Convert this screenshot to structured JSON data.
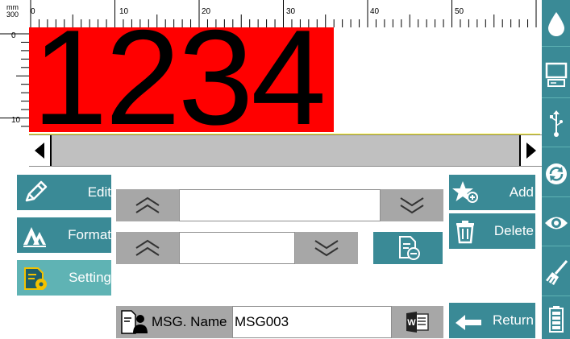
{
  "ruler": {
    "unit": "mm",
    "height_value": "300",
    "top_labels": [
      "0",
      "10",
      "20",
      "30",
      "40",
      "50"
    ],
    "left_labels": [
      "0",
      "10"
    ]
  },
  "preview": {
    "print_text": "1234",
    "block_color": "#ff0000",
    "text_color": "#000000"
  },
  "menu": [
    {
      "label": "Edit",
      "icon": "pencil-icon"
    },
    {
      "label": "Format",
      "icon": "font-format-icon"
    },
    {
      "label": "Setting",
      "icon": "document-settings-icon"
    }
  ],
  "fields": {
    "field1_value": "",
    "field2_value": ""
  },
  "actions": [
    {
      "label": "Add",
      "icon": "star-add-icon"
    },
    {
      "label": "Delete",
      "icon": "trash-icon"
    },
    {
      "label": "Return",
      "icon": "return-arrow-icon"
    }
  ],
  "msg": {
    "label": "MSG. Name",
    "value": "MSG003",
    "icon": "user-document-icon",
    "word_icon": "word-document-icon"
  },
  "sidebar": [
    {
      "icon": "ink-drop-icon"
    },
    {
      "icon": "computer-icon"
    },
    {
      "icon": "usb-icon"
    },
    {
      "icon": "refresh-icon"
    },
    {
      "icon": "eye-icon"
    },
    {
      "icon": "clean-brush-icon"
    },
    {
      "icon": "battery-icon"
    }
  ],
  "colors": {
    "accent": "#3a8a96",
    "accent_light": "#5fb3b4",
    "button_gray": "#a7a7a7",
    "scrollbar_gray": "#c0c0c0",
    "preview_red": "#ff0000"
  }
}
